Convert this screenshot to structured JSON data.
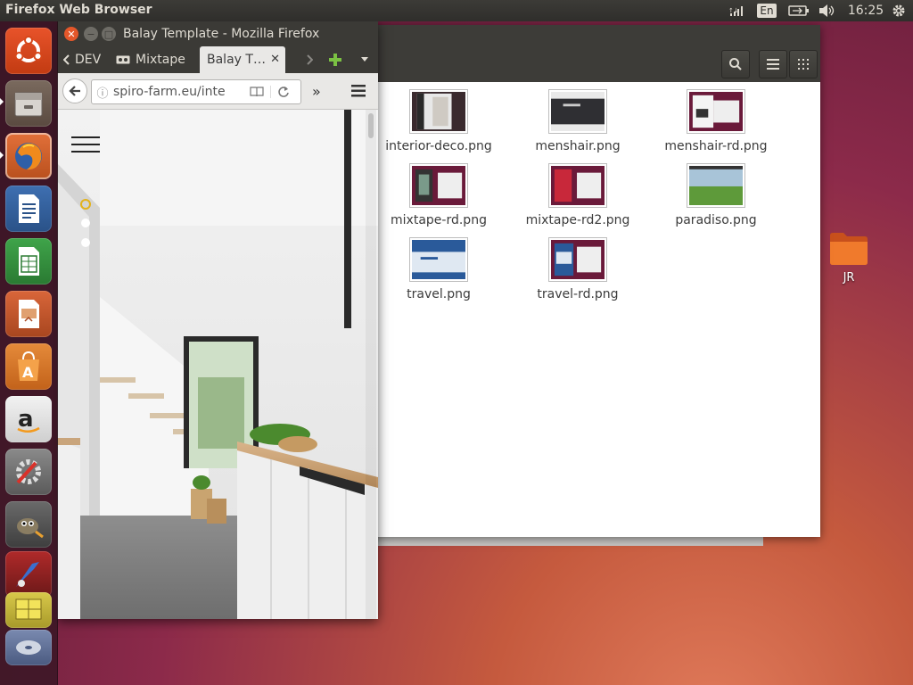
{
  "top_panel": {
    "app_title": "Firefox Web Browser",
    "language": "En",
    "clock": "16:25"
  },
  "firefox": {
    "window_title": "Balay Template - Mozilla Firefox",
    "tabs": [
      {
        "label": "DEV"
      },
      {
        "label": "Mixtape"
      },
      {
        "label": "Balay T…",
        "active": true
      }
    ],
    "url": "spiro-farm.eu/inte",
    "page": {
      "slider_dots": 3,
      "active_dot": 0
    }
  },
  "file_manager": {
    "files": [
      {
        "name": "interior-deco.png"
      },
      {
        "name": "menshair.png"
      },
      {
        "name": "menshair-rd.png"
      },
      {
        "name": "mixtape-rd.png"
      },
      {
        "name": "mixtape-rd2.png"
      },
      {
        "name": "paradiso.png"
      },
      {
        "name": "travel.png"
      },
      {
        "name": "travel-rd.png"
      }
    ]
  },
  "desktop": {
    "icons": [
      {
        "label": "JR"
      }
    ]
  },
  "colors": {
    "ubuntu_orange": "#dd4814",
    "panel_dark": "#3c3b37",
    "firefox_tab_active": "#e9e8e6"
  },
  "launcher": {
    "items": [
      "ubuntu-dash-icon",
      "files-icon",
      "firefox-icon",
      "writer-icon",
      "calc-icon",
      "impress-icon",
      "software-center-icon",
      "amazon-icon",
      "system-settings-icon",
      "gimp-icon",
      "wine-icon",
      "workspaces-icon",
      "disc-icon"
    ]
  }
}
